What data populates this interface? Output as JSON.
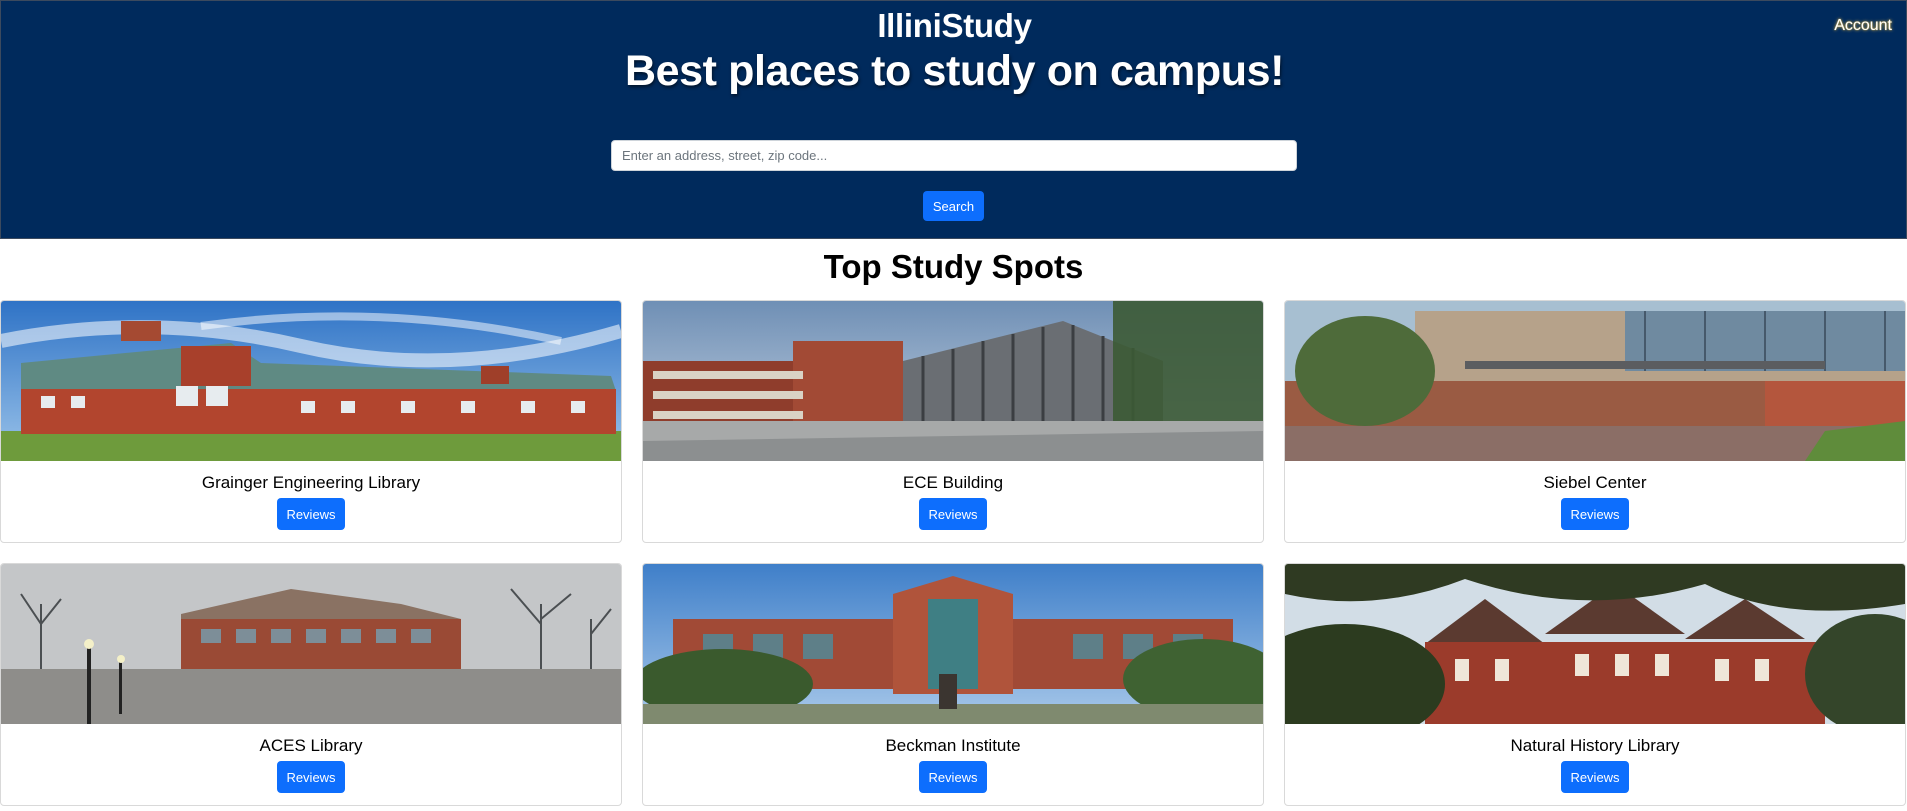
{
  "header": {
    "brand": "IlliniStudy",
    "tagline": "Best places to study on campus!",
    "account_label": "Account",
    "colors": {
      "background": "#002a5c",
      "text": "#ffffff"
    }
  },
  "search": {
    "placeholder": "Enter an address, street, zip code...",
    "value": "",
    "button_label": "Search"
  },
  "main": {
    "section_title": "Top Study Spots",
    "review_button_label": "Reviews",
    "accent_color": "#0d6efd",
    "spots": [
      {
        "name": "Grainger Engineering Library",
        "photo_icon": "building-photo-icon"
      },
      {
        "name": "ECE Building",
        "photo_icon": "building-photo-icon"
      },
      {
        "name": "Siebel Center",
        "photo_icon": "building-photo-icon"
      },
      {
        "name": "ACES Library",
        "photo_icon": "building-photo-icon"
      },
      {
        "name": "Beckman Institute",
        "photo_icon": "building-photo-icon"
      },
      {
        "name": "Natural History Library",
        "photo_icon": "building-photo-icon"
      }
    ]
  }
}
